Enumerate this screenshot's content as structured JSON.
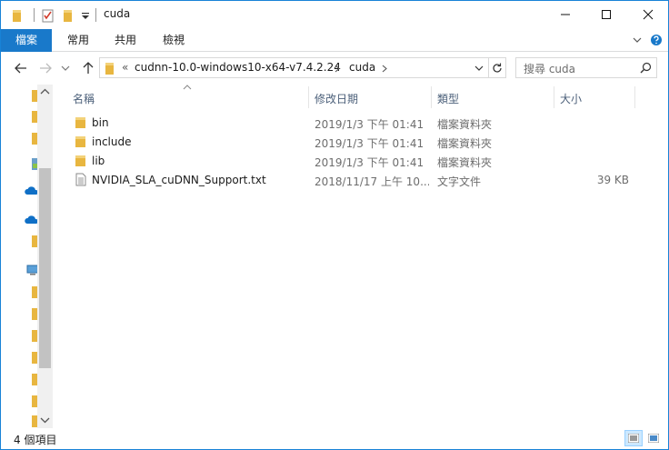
{
  "window": {
    "title": "cuda"
  },
  "ribbon": {
    "tabs": [
      {
        "label": "檔案"
      },
      {
        "label": "常用"
      },
      {
        "label": "共用"
      },
      {
        "label": "檢視"
      }
    ]
  },
  "address": {
    "overflow": "«",
    "crumbs": [
      "cudnn-10.0-windows10-x64-v7.4.2.24",
      "cuda"
    ]
  },
  "search": {
    "placeholder": "搜尋 cuda"
  },
  "columns": {
    "name": "名稱",
    "date": "修改日期",
    "type": "類型",
    "size": "大小"
  },
  "files": [
    {
      "name": "bin",
      "date": "2019/1/3 下午 01:41",
      "type": "檔案資料夾",
      "size": "",
      "icon": "folder-icon"
    },
    {
      "name": "include",
      "date": "2019/1/3 下午 01:41",
      "type": "檔案資料夾",
      "size": "",
      "icon": "folder-icon"
    },
    {
      "name": "lib",
      "date": "2019/1/3 下午 01:41",
      "type": "檔案資料夾",
      "size": "",
      "icon": "folder-icon"
    },
    {
      "name": "NVIDIA_SLA_cuDNN_Support.txt",
      "date": "2018/11/17 上午 10...",
      "type": "文字文件",
      "size": "39 KB",
      "icon": "text-file-icon"
    }
  ],
  "status": {
    "count": "4 個項目"
  },
  "colors": {
    "accent": "#1979ca",
    "folder": "#e8b640",
    "header_text": "#4c607a"
  }
}
